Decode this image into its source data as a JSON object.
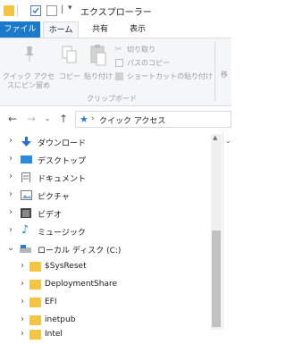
{
  "window": {
    "title": "エクスプローラー"
  },
  "tabs": {
    "file": "ファイル",
    "home": "ホーム",
    "share": "共有",
    "view": "表示"
  },
  "ribbon": {
    "quick_access_line1": "クイック アクセ",
    "quick_access_line2": "スにピン留め",
    "copy": "コピー",
    "paste": "貼り付け",
    "cut": "切り取り",
    "copy_path": "パスのコピー",
    "paste_shortcut": "ショートカットの貼り付け",
    "group_clipboard": "クリップボード",
    "move_partial": "移"
  },
  "address": {
    "path": "クイック アクセス"
  },
  "tree": {
    "items": [
      {
        "label": "ダウンロード",
        "icon": "download-icon"
      },
      {
        "label": "デスクトップ",
        "icon": "desktop-icon"
      },
      {
        "label": "ドキュメント",
        "icon": "document-icon"
      },
      {
        "label": "ピクチャ",
        "icon": "picture-icon"
      },
      {
        "label": "ビデオ",
        "icon": "video-icon"
      },
      {
        "label": "ミュージック",
        "icon": "music-icon"
      },
      {
        "label": "ローカル ディスク (C:)",
        "icon": "drive-icon"
      },
      {
        "label": "$SysReset",
        "icon": "folder-icon"
      },
      {
        "label": "DeploymentShare",
        "icon": "folder-icon"
      },
      {
        "label": "EFI",
        "icon": "folder-icon"
      },
      {
        "label": "inetpub",
        "icon": "folder-icon"
      },
      {
        "label": "Intel",
        "icon": "folder-icon"
      }
    ]
  }
}
